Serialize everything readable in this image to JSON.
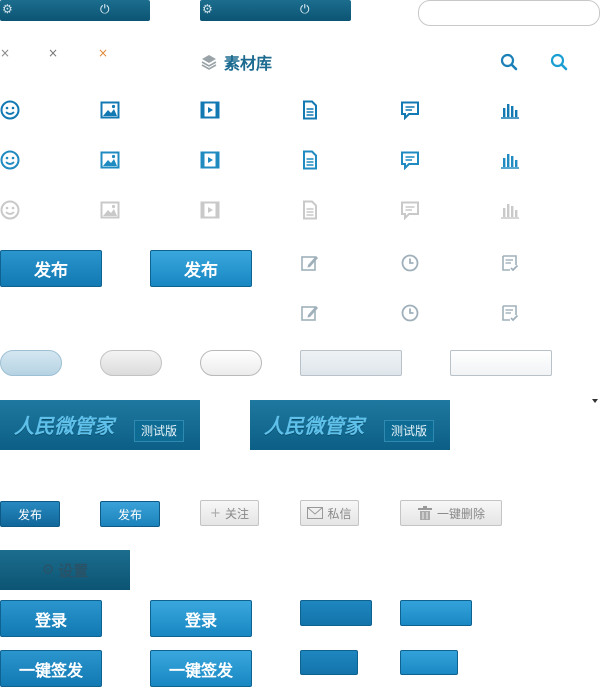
{
  "colors": {
    "accent": "#1279b3",
    "dark_bar": "#0c5473",
    "icon_blue": "#1f8bc0",
    "icon_gray": "#c9c9c9"
  },
  "library": {
    "title": "素材库"
  },
  "publish": {
    "label": "发布",
    "label_hover": "发布"
  },
  "banner": {
    "brand": "人民微管家",
    "badge": "测试版"
  },
  "small_buttons": {
    "publish": "发布",
    "publish_hover": "发布",
    "follow": "关注",
    "message": "私信",
    "delete_all": "一键删除"
  },
  "settings": {
    "label": "设置"
  },
  "login": {
    "label": "登录",
    "label_hover": "登录"
  },
  "sign_all": {
    "label": "一键签发",
    "label_hover": "一键签发"
  },
  "icons": {
    "row_icons": [
      "smiley-icon",
      "image-icon",
      "video-icon",
      "document-icon",
      "comment-icon",
      "chart-icon"
    ],
    "edit_icons": [
      "edit-icon",
      "clock-icon",
      "check-note-icon"
    ]
  }
}
